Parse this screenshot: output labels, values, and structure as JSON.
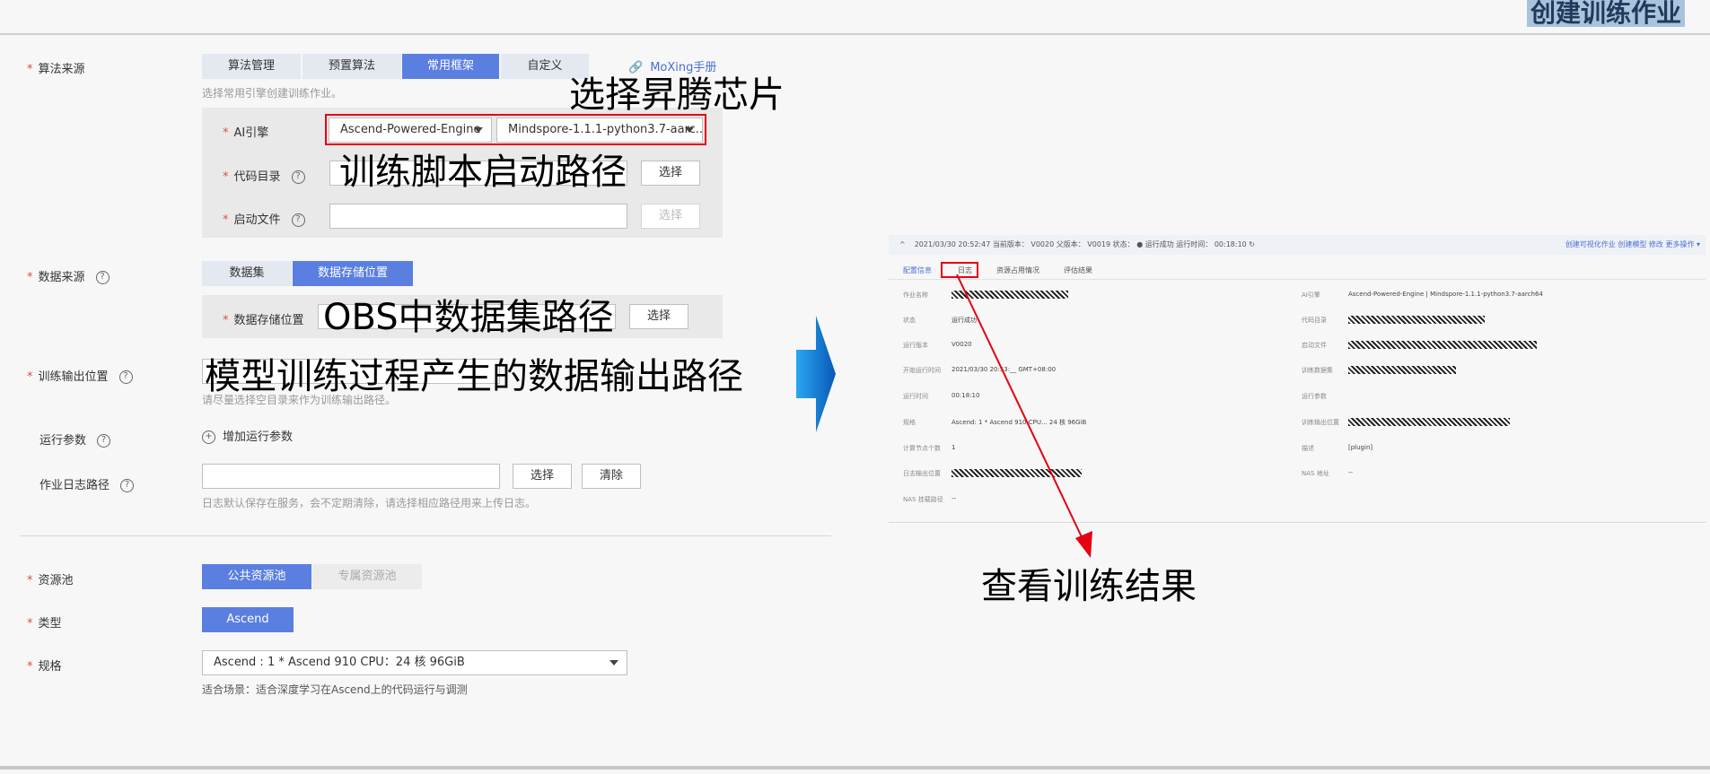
{
  "page_title": "创建训练作业",
  "algorithm_source": {
    "label": "算法来源",
    "tabs": [
      "算法管理",
      "预置算法",
      "常用框架",
      "自定义"
    ],
    "active_tab": 2,
    "moxing_link": "MoXing手册",
    "hint": "选择常用引擎创建训练作业。",
    "ai_engine_label": "AI引擎",
    "engine_value": "Ascend-Powered-Engine",
    "version_value": "Mindspore-1.1.1-python3.7-aarc...",
    "code_dir_label": "代码目录",
    "boot_file_label": "启动文件",
    "select_btn": "选择",
    "select_btn_disabled": "选择"
  },
  "data_source": {
    "label": "数据来源",
    "tabs": [
      "数据集",
      "数据存储位置"
    ],
    "active_tab": 1,
    "storage_label": "数据存储位置",
    "select_btn": "选择"
  },
  "train_output": {
    "label": "训练输出位置",
    "hint": "请尽量选择空目录来作为训练输出路径。"
  },
  "run_params": {
    "label": "运行参数",
    "add_label": "增加运行参数"
  },
  "job_log": {
    "label": "作业日志路径",
    "select_btn": "选择",
    "clear_btn": "清除",
    "hint": "日志默认保存在服务，会不定期清除，请选择相应路径用来上传日志。"
  },
  "resource_pool": {
    "label": "资源池",
    "tabs": [
      "公共资源池",
      "专属资源池"
    ],
    "active_tab": 0
  },
  "type": {
    "label": "类型",
    "value": "Ascend"
  },
  "spec": {
    "label": "规格",
    "value": "Ascend : 1 * Ascend 910 CPU：24 核 96GiB",
    "hint": "适合场景：适合深度学习在Ascend上的代码运行与调测"
  },
  "annotations": {
    "select_chip": "选择昇腾芯片",
    "script_path": "训练脚本启动路径",
    "obs_path": "OBS中数据集路径",
    "output_path": "模型训练过程产生的数据输出路径",
    "view_result": "查看训练结果"
  },
  "result_shot": {
    "header": "2021/03/30 20:52:47   当前版本： V0020   父版本： V0019   状态： ● 运行成功   运行时间： 00:18:10  ↻",
    "header_actions": "创建可视化作业   创建模型   修改   更多操作 ▾",
    "tabs": [
      "配置信息",
      "日志",
      "资源占用情况",
      "评估结果"
    ],
    "left": [
      {
        "k": "作业名称",
        "v": ""
      },
      {
        "k": "状态",
        "v": "运行成功"
      },
      {
        "k": "运行版本",
        "v": "V0020"
      },
      {
        "k": "开始运行时间",
        "v": "2021/03/30 20:53:__ GMT+08:00"
      },
      {
        "k": "运行时间",
        "v": "00:18:10"
      },
      {
        "k": "规格",
        "v": "Ascend: 1 * Ascend 910 CPU... 24 核 96GiB"
      },
      {
        "k": "计算节点个数",
        "v": "1"
      },
      {
        "k": "日志输出位置",
        "v": ""
      },
      {
        "k": "NAS 挂载路径",
        "v": "--"
      }
    ],
    "right": [
      {
        "k": "AI引擎",
        "v": "Ascend-Powered-Engine | Mindspore-1.1.1-python3.7-aarch64"
      },
      {
        "k": "代码目录",
        "v": ""
      },
      {
        "k": "启动文件",
        "v": ""
      },
      {
        "k": "训练数据集",
        "v": ""
      },
      {
        "k": "运行参数",
        "v": ""
      },
      {
        "k": "训练输出位置",
        "v": ""
      },
      {
        "k": "描述",
        "v": "[plugin]"
      },
      {
        "k": "NAS 地址",
        "v": "--"
      }
    ]
  },
  "colors": {
    "accent": "#5a7fe0",
    "red_box": "#e60012",
    "arrow_blue": "#0a6fd0"
  }
}
